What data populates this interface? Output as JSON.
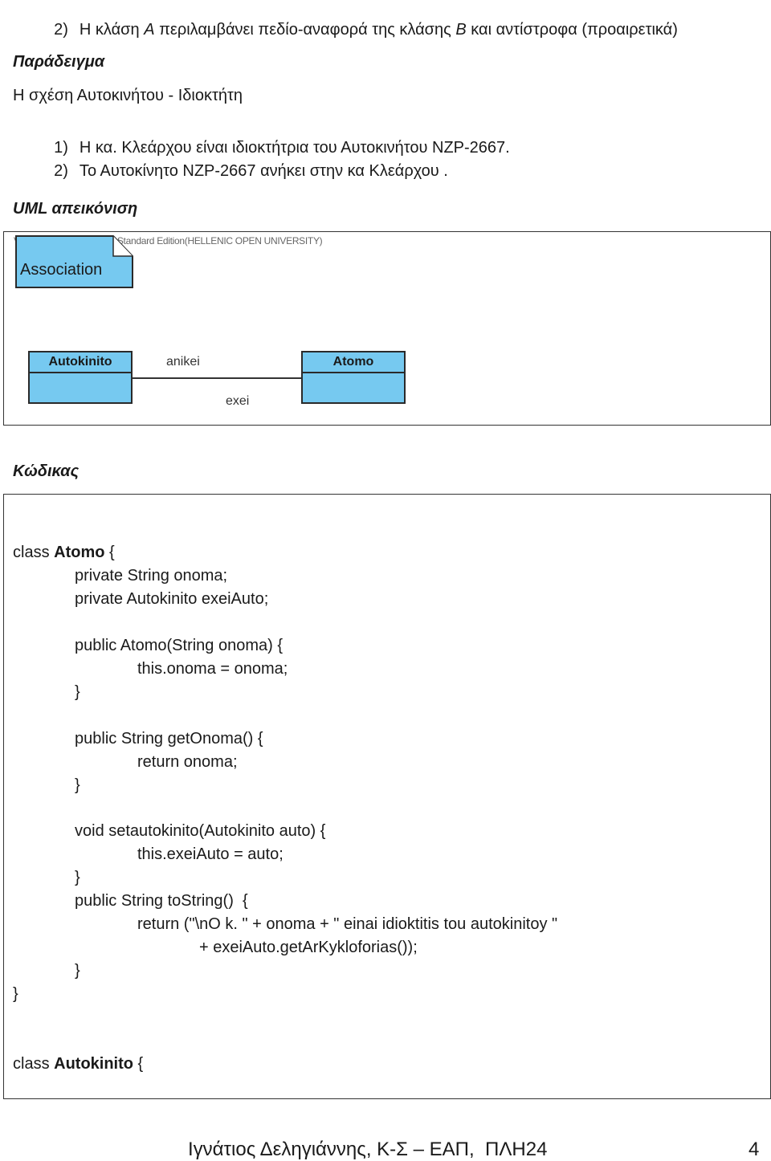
{
  "intro": {
    "item2_num": "2)",
    "item2_text_a": "Η κλάση ",
    "item2_A": "A",
    "item2_text_b": " περιλαμβάνει πεδίο-αναφορά της κλάσης ",
    "item2_B": "B",
    "item2_text_c": " και αντίστροφα (προαιρετικά)"
  },
  "example": {
    "heading": "Παράδειγμα",
    "relation": "Η σχέση Αυτοκινήτου - Ιδιοκτήτη",
    "items": [
      {
        "num": "1)",
        "text": "Η κα. Κλεάρχου είναι ιδιοκτήτρια του Αυτοκινήτου ΝΖΡ-2667."
      },
      {
        "num": "2)",
        "text": "Το Αυτοκίνητο ΝΖΡ-2667 ανήκει στην κα Κλεάρχου ."
      }
    ]
  },
  "uml": {
    "heading": "UML απεικόνιση",
    "watermark": "Visual Paradigm for UML Standard Edition(HELLENIC OPEN UNIVERSITY)",
    "note_label": "Association",
    "class_left": "Autokinito",
    "class_right": "Atomo",
    "assoc_top": "anikei",
    "assoc_bottom": "exei",
    "colors": {
      "class_fill": "#76c9f0",
      "border": "#2a2a2a"
    }
  },
  "code": {
    "heading": "Κώδικας",
    "lines": [
      {
        "pre": "class ",
        "bold": "Atomo",
        "post": " {"
      },
      {
        "text": "private String onoma;"
      },
      {
        "text": "private Autokinito exeiAuto;"
      },
      {
        "text": "public Atomo(String onoma) {"
      },
      {
        "text": "this.onoma = onoma;"
      },
      {
        "text": "}"
      },
      {
        "text": "public String getOnoma() {"
      },
      {
        "text": "return onoma;"
      },
      {
        "text": "}"
      },
      {
        "text": "void setautokinito(Autokinito auto) {"
      },
      {
        "text": "this.exeiAuto = auto;"
      },
      {
        "text": "}"
      },
      {
        "text": "public String toString()  {"
      },
      {
        "text": "return (\"\\nO k. \" + onoma + \" einai idioktitis tou autokinitoy \""
      },
      {
        "text": "+ exeiAuto.getArKykloforias());"
      },
      {
        "text": "}"
      },
      {
        "text": "}"
      },
      {
        "pre": "class ",
        "bold": "Autokinito",
        "post": " {"
      }
    ]
  },
  "footer": {
    "author": "Ιγνάτιος Δεληγιάννης, Κ-Σ – ΕΑΠ,  ΠΛΗ24",
    "page": "4"
  }
}
